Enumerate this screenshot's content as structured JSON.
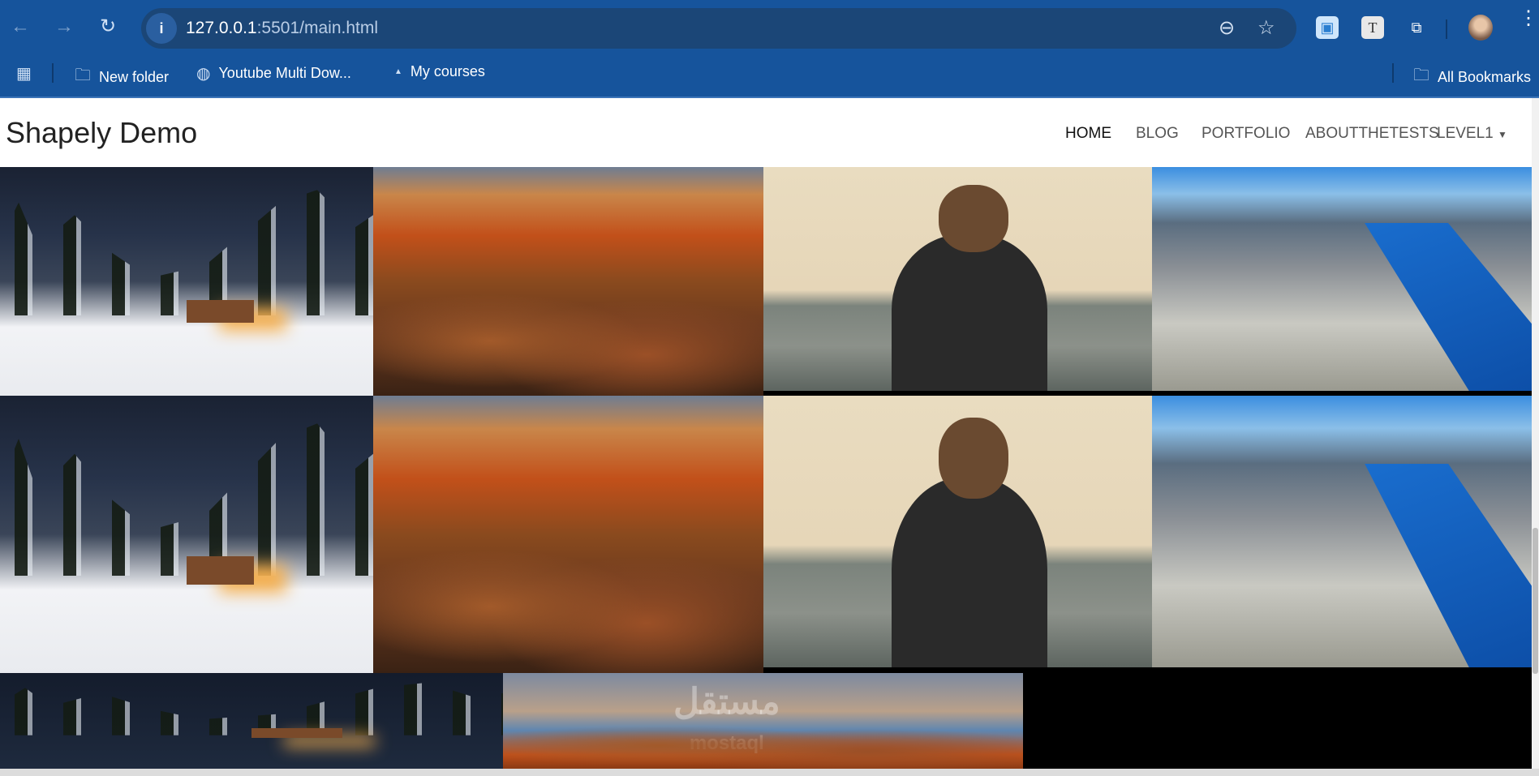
{
  "browser": {
    "url_host": "127.0.0.1",
    "url_path": ":5501/main.html",
    "bookmarks": [
      "New folder",
      "Youtube Multi Dow...",
      "My courses"
    ],
    "all_bookmarks": "All Bookmarks"
  },
  "site": {
    "title": "Shapely Demo",
    "nav": [
      "HOME",
      "BLOG",
      "PORTFOLIO",
      "ABOUTTHETESTS",
      "LEVEL1"
    ],
    "watermark": "مستقل mostaql"
  }
}
